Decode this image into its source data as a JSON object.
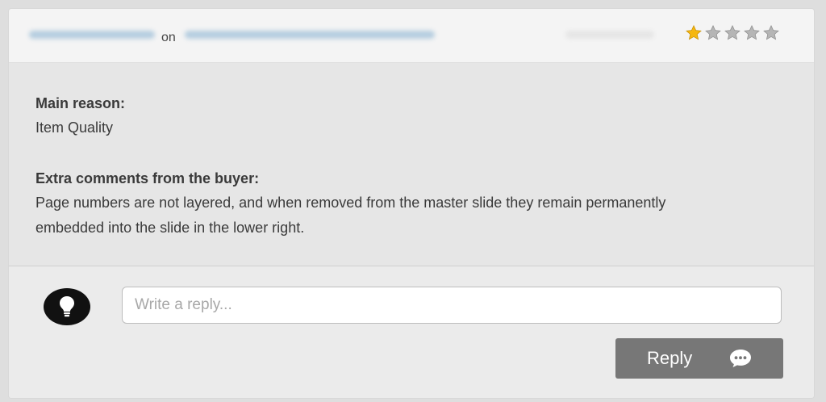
{
  "header": {
    "connector": "on",
    "rating": {
      "value": 1,
      "max": 5
    },
    "star_filled_color": "#f5b70f",
    "star_empty_color": "#b5b5b5"
  },
  "review": {
    "main_reason_label": "Main reason:",
    "main_reason_value": "Item Quality",
    "comments_label": "Extra comments from the buyer:",
    "comments_line1": "Page numbers are not layered, and when removed from the master slide they remain permanently",
    "comments_line2": "embedded into the slide in the lower right."
  },
  "reply": {
    "placeholder": "Write a reply...",
    "button_label": "Reply",
    "avatar_icon": "lightbulb-icon",
    "button_icon": "speech-bubble-icon"
  }
}
